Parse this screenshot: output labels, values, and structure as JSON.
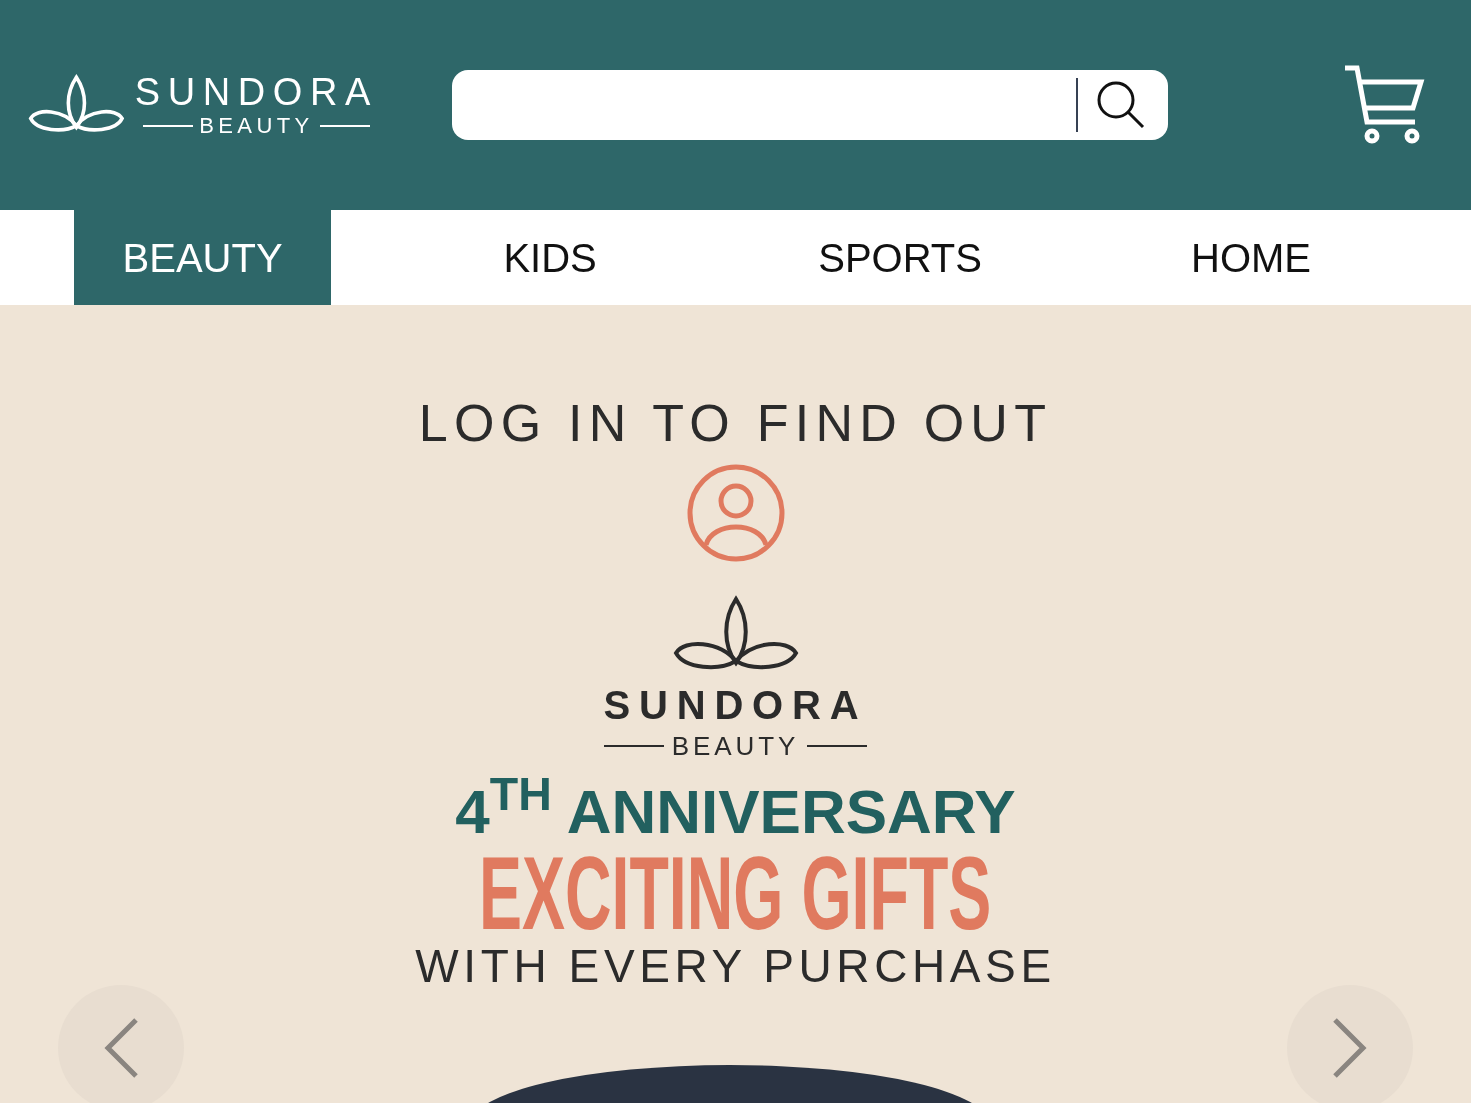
{
  "header": {
    "logo": {
      "name": "SUNDORA",
      "tagline": "BEAUTY"
    }
  },
  "tabs": [
    {
      "label": "BEAUTY",
      "selected": true
    },
    {
      "label": "KIDS",
      "selected": false
    },
    {
      "label": "SPORTS",
      "selected": false
    },
    {
      "label": "HOME",
      "selected": false
    }
  ],
  "banner": {
    "headline": "LOG IN TO FIND OUT",
    "brand": {
      "name": "SUNDORA",
      "tagline": "BEAUTY"
    },
    "anniversary": "4$^{TH}$ ANNIVERSARY",
    "offer": "EXCITING GIFTS",
    "subline": "WITH EVERY PURCHASE"
  }
}
